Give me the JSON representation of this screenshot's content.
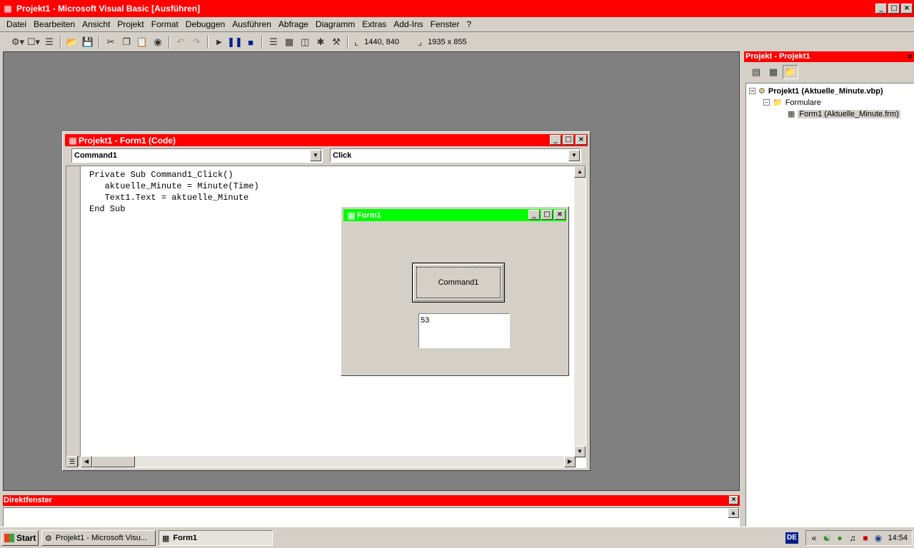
{
  "main_window": {
    "title": "Projekt1 - Microsoft Visual Basic [Ausführen]"
  },
  "menu": [
    "Datei",
    "Bearbeiten",
    "Ansicht",
    "Projekt",
    "Format",
    "Debuggen",
    "Ausführen",
    "Abfrage",
    "Diagramm",
    "Extras",
    "Add-Ins",
    "Fenster",
    "?"
  ],
  "toolbar": {
    "position_readout": "1440, 840",
    "size_readout": "1935 x 855"
  },
  "project_explorer": {
    "title": "Projekt - Projekt1",
    "project_node": "Projekt1 (Aktuelle_Minute.vbp)",
    "folder_node": "Formulare",
    "form_node": "Form1 (Aktuelle_Minute.frm)"
  },
  "code_window": {
    "title": "Projekt1 - Form1 (Code)",
    "object_combo": "Command1",
    "procedure_combo": "Click",
    "code_lines": [
      "Private Sub Command1_Click()",
      "   aktuelle_Minute = Minute(Time)",
      "   Text1.Text = aktuelle_Minute",
      "End Sub"
    ]
  },
  "form1": {
    "title": "Form1",
    "button_label": "Command1",
    "textbox_value": "53"
  },
  "immediate_window": {
    "title": "Direktfenster"
  },
  "taskbar": {
    "start_label": "Start",
    "task1": "Projekt1 - Microsoft Visu...",
    "task2": "Form1",
    "lang": "DE",
    "clock": "14:54"
  },
  "colors": {
    "active_title": "#ff0000",
    "form_title": "#00ff00",
    "mdi_background": "#808080",
    "face": "#d4d0c8"
  }
}
